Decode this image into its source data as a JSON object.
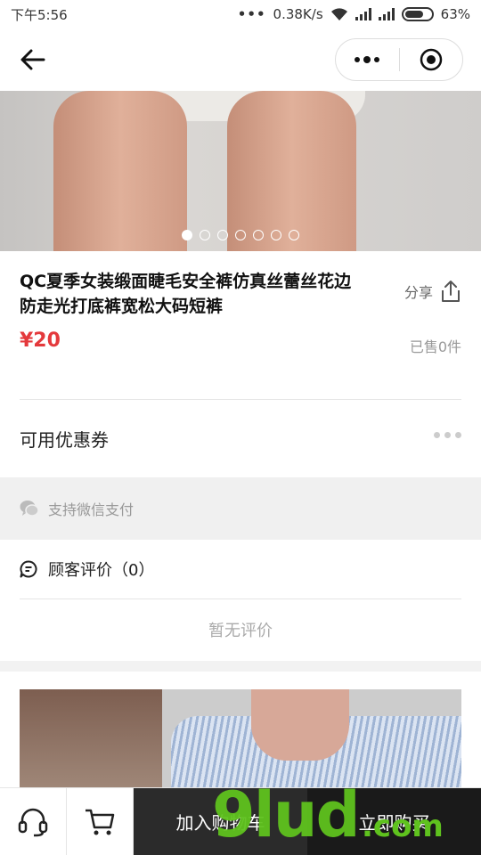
{
  "status_bar": {
    "time": "下午5:56",
    "speed": "0.38K/s",
    "battery": "63%"
  },
  "product": {
    "title": "QC夏季女装缎面睫毛安全裤仿真丝蕾丝花边防走光打底裤宽松大码短裤",
    "price": "¥20",
    "sold": "已售0件",
    "share_label": "分享",
    "carousel_count": 7,
    "carousel_active": 1
  },
  "coupon": {
    "label": "可用优惠券"
  },
  "payment": {
    "label": "支持微信支付"
  },
  "reviews": {
    "title": "顾客评价（0）",
    "empty": "暂无评价"
  },
  "bottom_bar": {
    "add_to_cart": "加入购物车",
    "buy_now": "立即购买"
  },
  "watermark": {
    "text": "9lud",
    "suffix": ".com"
  },
  "colors": {
    "price": "#e4393c",
    "watermark": "#5fc21e"
  }
}
